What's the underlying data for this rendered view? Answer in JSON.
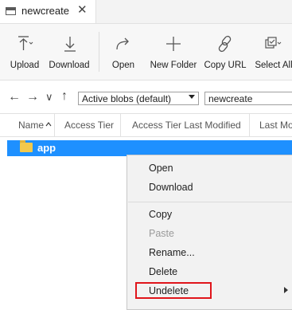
{
  "tab": {
    "title": "newcreate",
    "close": "✕"
  },
  "toolbar": {
    "upload": "Upload",
    "download": "Download",
    "open": "Open",
    "new_folder": "New Folder",
    "copy_url": "Copy URL",
    "select_all": "Select All"
  },
  "nav": {
    "back": "←",
    "forward": "→",
    "history": "∨",
    "up": "↑",
    "view_filter": "Active blobs (default)",
    "path": "newcreate"
  },
  "columns": [
    "Name",
    "Access Tier",
    "Access Tier Last Modified",
    "Last Mo"
  ],
  "rows": [
    {
      "name": "app",
      "selected": true
    }
  ],
  "context_menu": {
    "items": [
      "Open",
      "Download",
      "Copy",
      "Paste",
      "Rename...",
      "Delete",
      "Undelete"
    ],
    "disabled": [
      "Paste"
    ]
  },
  "colors": {
    "selection": "#1e90ff",
    "highlight_box": "#e0151b",
    "folder": "#f2c94c"
  }
}
